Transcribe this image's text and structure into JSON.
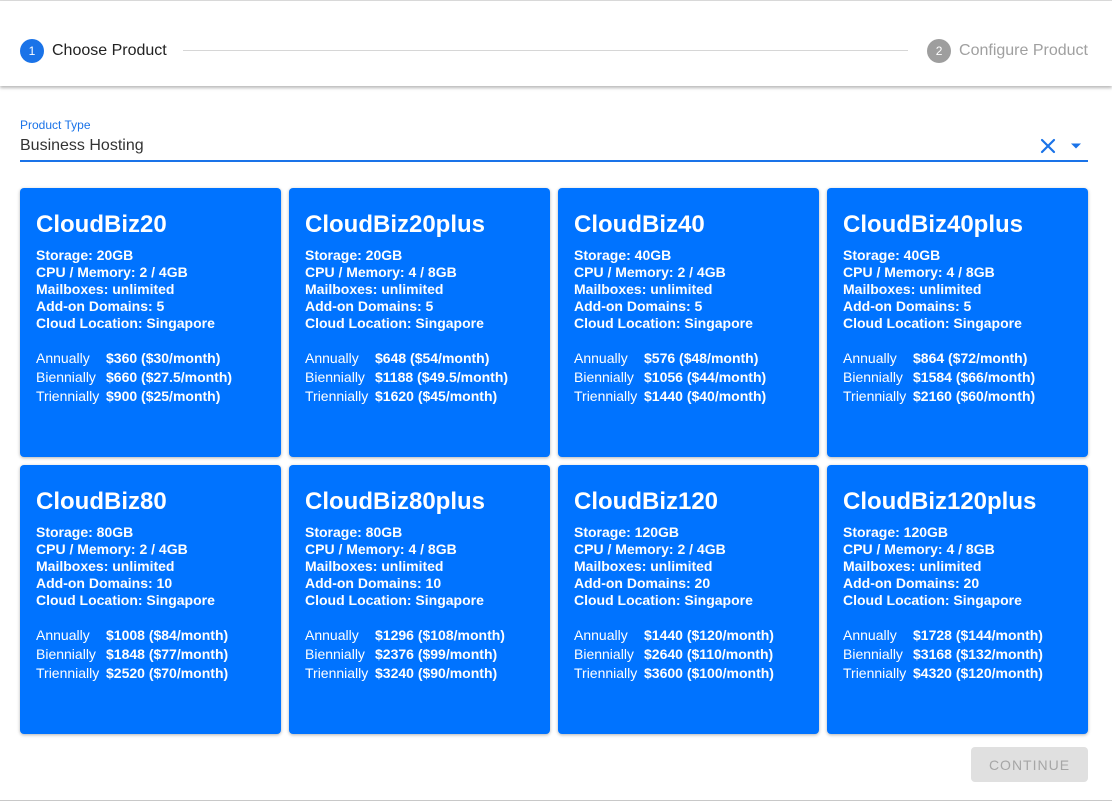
{
  "stepper": {
    "steps": [
      {
        "number": "1",
        "label": "Choose Product",
        "state": "active"
      },
      {
        "number": "2",
        "label": "Configure Product",
        "state": "inactive"
      }
    ]
  },
  "product_type": {
    "label": "Product Type",
    "value": "Business Hosting"
  },
  "products": [
    {
      "name": "CloudBiz20",
      "specs": [
        "Storage: 20GB",
        "CPU / Memory: 2 / 4GB",
        "Mailboxes: unlimited",
        "Add-on Domains: 5",
        "Cloud Location: Singapore"
      ],
      "prices": [
        {
          "term": "Annually",
          "price": "$360 ($30/month)"
        },
        {
          "term": "Biennially",
          "price": "$660 ($27.5/month)"
        },
        {
          "term": "Triennially",
          "price": "$900 ($25/month)"
        }
      ]
    },
    {
      "name": "CloudBiz20plus",
      "specs": [
        "Storage: 20GB",
        "CPU / Memory: 4 / 8GB",
        "Mailboxes: unlimited",
        "Add-on Domains: 5",
        "Cloud Location: Singapore"
      ],
      "prices": [
        {
          "term": "Annually",
          "price": "$648 ($54/month)"
        },
        {
          "term": "Biennially",
          "price": "$1188 ($49.5/month)"
        },
        {
          "term": "Triennially",
          "price": "$1620 ($45/month)"
        }
      ]
    },
    {
      "name": "CloudBiz40",
      "specs": [
        "Storage: 40GB",
        "CPU / Memory: 2 / 4GB",
        "Mailboxes: unlimited",
        "Add-on Domains: 5",
        "Cloud Location: Singapore"
      ],
      "prices": [
        {
          "term": "Annually",
          "price": "$576 ($48/month)"
        },
        {
          "term": "Biennially",
          "price": "$1056 ($44/month)"
        },
        {
          "term": "Triennially",
          "price": "$1440 ($40/month)"
        }
      ]
    },
    {
      "name": "CloudBiz40plus",
      "specs": [
        "Storage: 40GB",
        "CPU / Memory: 4 / 8GB",
        "Mailboxes: unlimited",
        "Add-on Domains: 5",
        "Cloud Location: Singapore"
      ],
      "prices": [
        {
          "term": "Annually",
          "price": "$864 ($72/month)"
        },
        {
          "term": "Biennially",
          "price": "$1584 ($66/month)"
        },
        {
          "term": "Triennially",
          "price": "$2160 ($60/month)"
        }
      ]
    },
    {
      "name": "CloudBiz80",
      "specs": [
        "Storage: 80GB",
        "CPU / Memory: 2 / 4GB",
        "Mailboxes: unlimited",
        "Add-on Domains: 10",
        "Cloud Location: Singapore"
      ],
      "prices": [
        {
          "term": "Annually",
          "price": "$1008 ($84/month)"
        },
        {
          "term": "Biennially",
          "price": "$1848 ($77/month)"
        },
        {
          "term": "Triennially",
          "price": "$2520 ($70/month)"
        }
      ]
    },
    {
      "name": "CloudBiz80plus",
      "specs": [
        "Storage: 80GB",
        "CPU / Memory: 4 / 8GB",
        "Mailboxes: unlimited",
        "Add-on Domains: 10",
        "Cloud Location: Singapore"
      ],
      "prices": [
        {
          "term": "Annually",
          "price": "$1296 ($108/month)"
        },
        {
          "term": "Biennially",
          "price": "$2376 ($99/month)"
        },
        {
          "term": "Triennially",
          "price": "$3240 ($90/month)"
        }
      ]
    },
    {
      "name": "CloudBiz120",
      "specs": [
        "Storage: 120GB",
        "CPU / Memory: 2 / 4GB",
        "Mailboxes: unlimited",
        "Add-on Domains: 20",
        "Cloud Location: Singapore"
      ],
      "prices": [
        {
          "term": "Annually",
          "price": "$1440 ($120/month)"
        },
        {
          "term": "Biennially",
          "price": "$2640 ($110/month)"
        },
        {
          "term": "Triennially",
          "price": "$3600 ($100/month)"
        }
      ]
    },
    {
      "name": "CloudBiz120plus",
      "specs": [
        "Storage: 120GB",
        "CPU / Memory: 4 / 8GB",
        "Mailboxes: unlimited",
        "Add-on Domains: 20",
        "Cloud Location: Singapore"
      ],
      "prices": [
        {
          "term": "Annually",
          "price": "$1728 ($144/month)"
        },
        {
          "term": "Biennially",
          "price": "$3168 ($132/month)"
        },
        {
          "term": "Triennially",
          "price": "$4320 ($120/month)"
        }
      ]
    }
  ],
  "actions": {
    "continue_label": "CONTINUE",
    "continue_disabled": true
  },
  "icons": {
    "clear": "close-icon",
    "dropdown": "caret-down-icon"
  },
  "colors": {
    "primary": "#1a73e8",
    "card": "#0073ff",
    "step_inactive": "#9e9e9e",
    "button_disabled_bg": "#e0e0e0",
    "button_disabled_text": "#a6a6a6"
  }
}
